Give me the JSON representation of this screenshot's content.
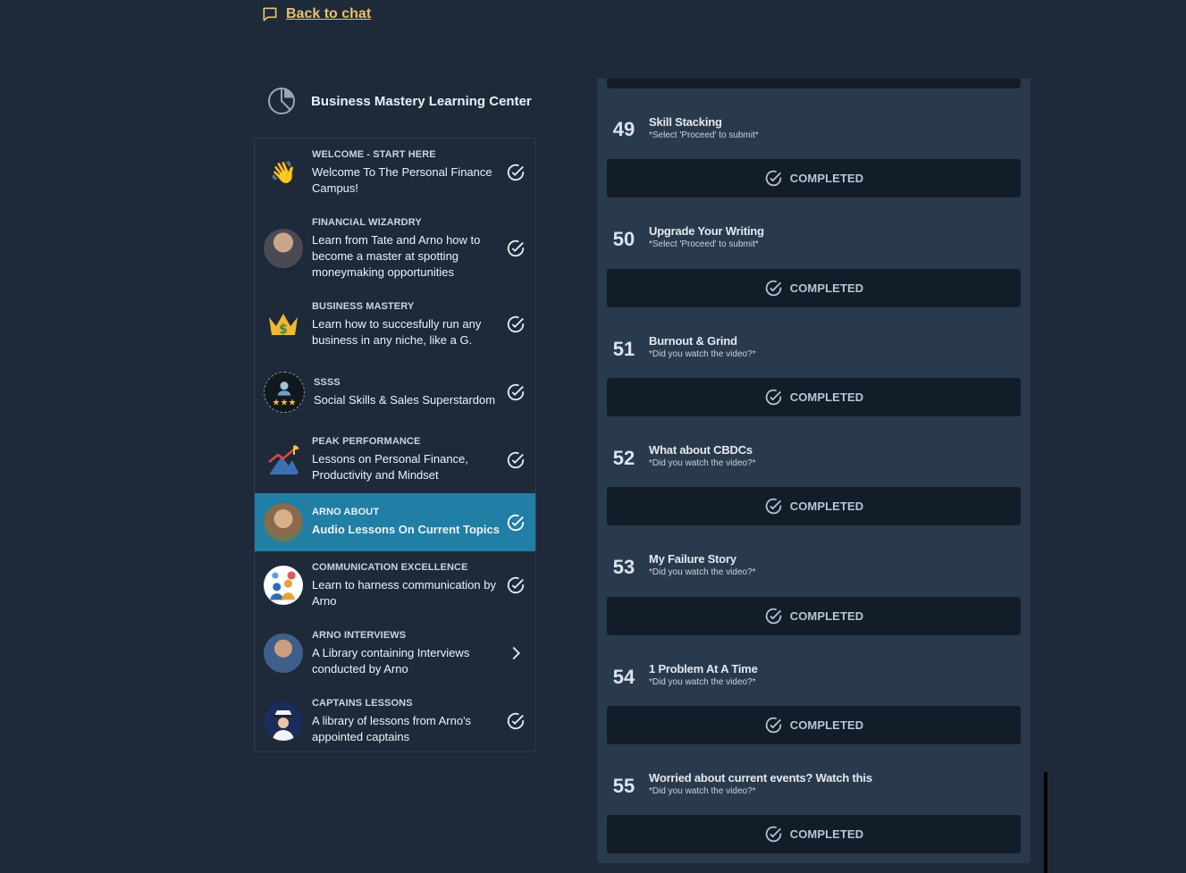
{
  "nav": {
    "back_label": "Back to chat"
  },
  "learning_center": {
    "title": "Business Mastery Learning Center"
  },
  "courses": [
    {
      "tag": "WELCOME - START HERE",
      "desc": "Welcome To The Personal Finance Campus!",
      "status": "check",
      "icon": "waving-hand-icon"
    },
    {
      "tag": "FINANCIAL WIZARDRY",
      "desc": "Learn from Tate and Arno how to become a master at spotting moneymaking opportunities",
      "status": "check",
      "icon": "tate-avatar"
    },
    {
      "tag": "BUSINESS MASTERY",
      "desc": "Learn how to succesfully run any business in any niche, like a G.",
      "status": "check",
      "icon": "crown-dollar-icon"
    },
    {
      "tag": "SSSS",
      "desc": "Social Skills & Sales Superstardom",
      "status": "check",
      "icon": "stars-person-icon"
    },
    {
      "tag": "PEAK PERFORMANCE",
      "desc": "Lessons on Personal Finance, Productivity and Mindset",
      "status": "check",
      "icon": "mountain-chart-icon"
    },
    {
      "tag": "ARNO ABOUT",
      "desc": "Audio Lessons On Current Topics",
      "status": "check",
      "icon": "arno-avatar",
      "active": true
    },
    {
      "tag": "COMMUNICATION EXCELLENCE",
      "desc": "Learn to harness communication by Arno",
      "status": "check",
      "icon": "chat-people-icon"
    },
    {
      "tag": "ARNO INTERVIEWS",
      "desc": "A Library containing Interviews conducted by Arno",
      "status": "chevron",
      "icon": "arno-interview-avatar"
    },
    {
      "tag": "CAPTAINS LESSONS",
      "desc": "A library of lessons from Arno's appointed captains",
      "status": "check",
      "icon": "captain-icon"
    }
  ],
  "lessons": [
    {
      "num": "49",
      "title": "Skill Stacking",
      "sub": "*Select 'Proceed' to submit*",
      "button": "COMPLETED"
    },
    {
      "num": "50",
      "title": "Upgrade Your Writing",
      "sub": "*Select 'Proceed' to submit*",
      "button": "COMPLETED"
    },
    {
      "num": "51",
      "title": "Burnout & Grind",
      "sub": "*Did you watch the video?*",
      "button": "COMPLETED"
    },
    {
      "num": "52",
      "title": "What about CBDCs",
      "sub": "*Did you watch the video?*",
      "button": "COMPLETED"
    },
    {
      "num": "53",
      "title": "My Failure Story",
      "sub": "*Did you watch the video?*",
      "button": "COMPLETED"
    },
    {
      "num": "54",
      "title": "1 Problem At A Time",
      "sub": "*Did you watch the video?*",
      "button": "COMPLETED"
    },
    {
      "num": "55",
      "title": "Worried about current events? Watch this",
      "sub": "*Did you watch the video?*",
      "button": "COMPLETED"
    }
  ],
  "colors": {
    "background": "#1e2a3a",
    "accent": "#217ea5",
    "link": "#e8c26e",
    "panel": "#2a3a4d",
    "button": "#131d2a"
  }
}
